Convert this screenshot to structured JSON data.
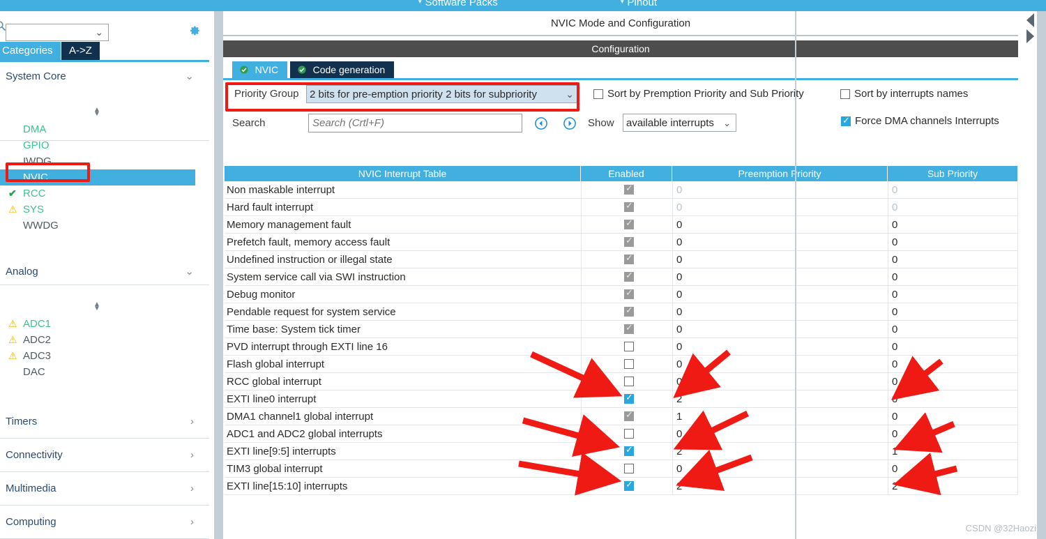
{
  "topbar": {
    "items": [
      {
        "label": "Software Packs",
        "caret": "▾"
      },
      {
        "label": "Pinout",
        "caret": "▾"
      }
    ]
  },
  "sidebar": {
    "search_value": "",
    "search_icon": "search-icon",
    "gear_icon": "gear-icon",
    "tabs": [
      {
        "label": "Categories",
        "selected": true
      },
      {
        "label": "A->Z",
        "selected": false
      }
    ],
    "groups": [
      {
        "label": "System Core",
        "expanded": true,
        "items": [
          {
            "label": "DMA",
            "status": "",
            "color": "green"
          },
          {
            "label": "GPIO",
            "status": "",
            "color": "green"
          },
          {
            "label": "IWDG",
            "status": "",
            "color": "plain"
          },
          {
            "label": "NVIC",
            "status": "",
            "color": "plain",
            "selected": true
          },
          {
            "label": "RCC",
            "status": "ok",
            "color": "green"
          },
          {
            "label": "SYS",
            "status": "warn",
            "color": "green"
          },
          {
            "label": "WWDG",
            "status": "",
            "color": "plain"
          }
        ]
      },
      {
        "label": "Analog",
        "expanded": true,
        "items": [
          {
            "label": "ADC1",
            "status": "warn",
            "color": "green"
          },
          {
            "label": "ADC2",
            "status": "warn",
            "color": "plain"
          },
          {
            "label": "ADC3",
            "status": "warn",
            "color": "plain"
          },
          {
            "label": "DAC",
            "status": "",
            "color": "plain"
          }
        ]
      },
      {
        "label": "Timers",
        "expanded": false,
        "items": []
      },
      {
        "label": "Connectivity",
        "expanded": false,
        "items": []
      },
      {
        "label": "Multimedia",
        "expanded": false,
        "items": []
      },
      {
        "label": "Computing",
        "expanded": false,
        "items": []
      }
    ]
  },
  "main": {
    "title": "NVIC Mode and Configuration",
    "configuration_band": "Configuration",
    "tabs": [
      {
        "label": "NVIC",
        "check": "✔",
        "selected": true
      },
      {
        "label": "Code generation",
        "check": "✔",
        "selected": false
      }
    ],
    "priority_group": {
      "label": "Priority Group",
      "value": "2 bits for pre-emption priority 2 bits for subpriority",
      "chevron": "⌄"
    },
    "sort_premption": {
      "label": "Sort by Premption Priority and Sub Priority",
      "checked": false
    },
    "sort_names": {
      "label": "Sort by interrupts names",
      "checked": false
    },
    "search": {
      "label": "Search",
      "value": "",
      "placeholder": "Search (Crtl+F)",
      "prev_icon": "arrow-left-circle-icon",
      "next_icon": "arrow-right-circle-icon"
    },
    "show": {
      "label": "Show",
      "value": "available interrupts",
      "chevron": "⌄"
    },
    "force_dma": {
      "label": "Force DMA channels Interrupts",
      "checked": true
    }
  },
  "table": {
    "columns": [
      "NVIC Interrupt Table",
      "Enabled",
      "Preemption Priority",
      "Sub Priority"
    ],
    "rows": [
      {
        "name": "Non maskable interrupt",
        "enabled": "disabled-checked",
        "preemption": "0",
        "sub": "0",
        "dim": true
      },
      {
        "name": "Hard fault interrupt",
        "enabled": "disabled-checked",
        "preemption": "0",
        "sub": "0",
        "dim": true
      },
      {
        "name": "Memory management fault",
        "enabled": "disabled-checked",
        "preemption": "0",
        "sub": "0",
        "dim": false
      },
      {
        "name": "Prefetch fault, memory access fault",
        "enabled": "disabled-checked",
        "preemption": "0",
        "sub": "0",
        "dim": false
      },
      {
        "name": "Undefined instruction or illegal state",
        "enabled": "disabled-checked",
        "preemption": "0",
        "sub": "0",
        "dim": false
      },
      {
        "name": "System service call via SWI instruction",
        "enabled": "disabled-checked",
        "preemption": "0",
        "sub": "0",
        "dim": false
      },
      {
        "name": "Debug monitor",
        "enabled": "disabled-checked",
        "preemption": "0",
        "sub": "0",
        "dim": false
      },
      {
        "name": "Pendable request for system service",
        "enabled": "disabled-checked",
        "preemption": "0",
        "sub": "0",
        "dim": false
      },
      {
        "name": "Time base: System tick timer",
        "enabled": "disabled-checked",
        "preemption": "0",
        "sub": "0",
        "dim": false
      },
      {
        "name": "PVD interrupt through EXTI line 16",
        "enabled": "unchecked",
        "preemption": "0",
        "sub": "0",
        "dim": false
      },
      {
        "name": "Flash global interrupt",
        "enabled": "unchecked",
        "preemption": "0",
        "sub": "0",
        "dim": false
      },
      {
        "name": "RCC global interrupt",
        "enabled": "unchecked",
        "preemption": "0",
        "sub": "0",
        "dim": false
      },
      {
        "name": "EXTI line0 interrupt",
        "enabled": "checked",
        "preemption": "2",
        "sub": "0",
        "dim": false
      },
      {
        "name": "DMA1 channel1 global interrupt",
        "enabled": "disabled-checked",
        "preemption": "1",
        "sub": "0",
        "dim": false
      },
      {
        "name": "ADC1 and ADC2 global interrupts",
        "enabled": "unchecked",
        "preemption": "0",
        "sub": "0",
        "dim": false
      },
      {
        "name": "EXTI line[9:5] interrupts",
        "enabled": "checked",
        "preemption": "2",
        "sub": "1",
        "dim": false
      },
      {
        "name": "TIM3 global interrupt",
        "enabled": "unchecked",
        "preemption": "0",
        "sub": "0",
        "dim": false
      },
      {
        "name": "EXTI line[15:10] interrupts",
        "enabled": "checked",
        "preemption": "2",
        "sub": "2",
        "dim": false
      }
    ]
  },
  "annotations": {
    "highlight_color": "#f01a14",
    "boxes": [
      "nvic-sidebar-item",
      "priority-group-row"
    ],
    "arrow_count": 9
  },
  "watermark": "CSDN @32Haozi",
  "colors": {
    "accent": "#41b0e0",
    "dark_tab": "#11314f",
    "band": "#4d4d4d",
    "check_on": "#2aa6e0",
    "check_disabled": "#9a9a9a",
    "annotation": "#f01a14",
    "green_text": "#3fbf8f",
    "warn": "#f5b700"
  }
}
